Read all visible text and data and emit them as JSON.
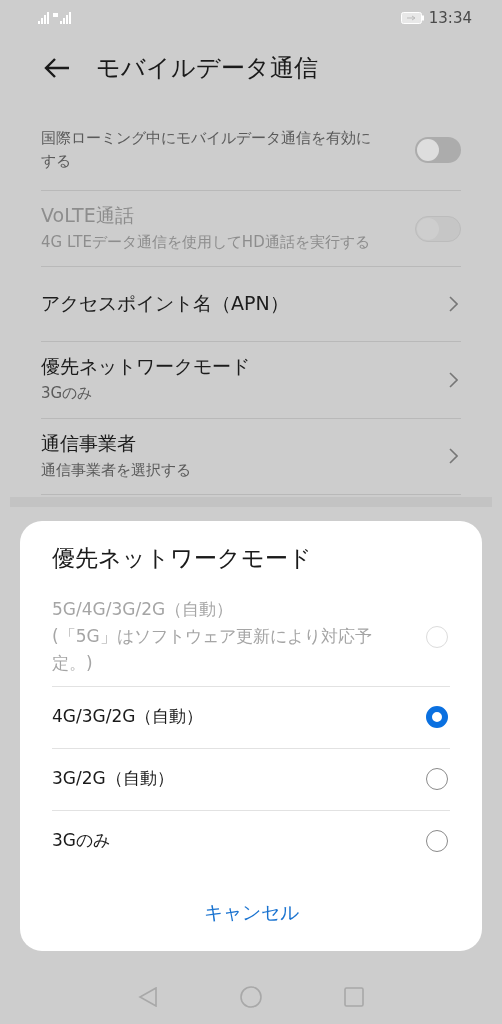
{
  "status_bar": {
    "time": "13:34"
  },
  "header": {
    "title": "モバイルデータ通信"
  },
  "settings": [
    {
      "kind": "toggle",
      "subtitle": "国際ローミング中にモバイルデータ通信を有効にする",
      "on": false,
      "disabled": false
    },
    {
      "kind": "toggle",
      "title": "VoLTE通話",
      "subtitle": "4G LTEデータ通信を使用してHD通話を実行する",
      "on": false,
      "disabled": true
    },
    {
      "kind": "link",
      "title": "アクセスポイント名（APN）"
    },
    {
      "kind": "link",
      "title": "優先ネットワークモード",
      "subtitle": "3Gのみ"
    },
    {
      "kind": "link",
      "title": "通信事業者",
      "subtitle": "通信事業者を選択する"
    }
  ],
  "dialog": {
    "title": "優先ネットワークモード",
    "options": [
      {
        "label": "5G/4G/3G/2G（自動）\n(「5G」はソフトウェア更新により対応予定。)",
        "selected": false,
        "disabled": true
      },
      {
        "label": "4G/3G/2G（自動）",
        "selected": true,
        "disabled": false
      },
      {
        "label": "3G/2G（自動）",
        "selected": false,
        "disabled": false
      },
      {
        "label": "3Gのみ",
        "selected": false,
        "disabled": false
      }
    ],
    "cancel": "キャンセル"
  }
}
